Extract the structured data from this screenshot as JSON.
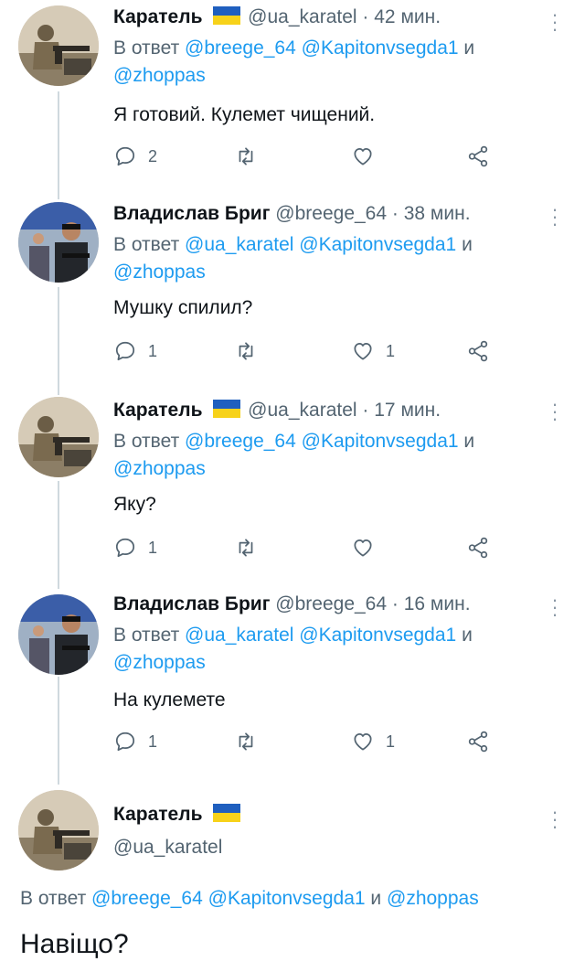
{
  "tweets": [
    {
      "name": "Каратель",
      "handle": "@ua_karatel",
      "sep": "·",
      "time": "42 мин.",
      "reply_prefix": "В ответ",
      "reply_to_1": "@breege_64",
      "reply_to_2": "@Kapitonvsegda1",
      "reply_and": "и",
      "reply_to_3": "@zhoppas",
      "text": "Я готовий. Кулемет чищений.",
      "replies": "2",
      "likes": ""
    },
    {
      "name": "Владислав Бриг",
      "handle": "@breege_64",
      "sep": "·",
      "time": "38 мин.",
      "reply_prefix": "В ответ",
      "reply_to_1": "@ua_karatel",
      "reply_to_2": "@Kapitonvsegda1",
      "reply_and": "и",
      "reply_to_3": "@zhoppas",
      "text": "Мушку спилил?",
      "replies": "1",
      "likes": "1"
    },
    {
      "name": "Каратель",
      "handle": "@ua_karatel",
      "sep": "·",
      "time": "17 мин.",
      "reply_prefix": "В ответ",
      "reply_to_1": "@breege_64",
      "reply_to_2": "@Kapitonvsegda1",
      "reply_and": "и",
      "reply_to_3": "@zhoppas",
      "text": "Яку?",
      "replies": "1",
      "likes": ""
    },
    {
      "name": "Владислав Бриг",
      "handle": "@breege_64",
      "sep": "·",
      "time": "16 мин.",
      "reply_prefix": "В ответ",
      "reply_to_1": "@ua_karatel",
      "reply_to_2": "@Kapitonvsegda1",
      "reply_and": "и",
      "reply_to_3": "@zhoppas",
      "text": "На кулемете",
      "replies": "1",
      "likes": "1"
    }
  ],
  "main_tweet": {
    "name": "Каратель",
    "handle": "@ua_karatel",
    "reply_prefix": "В ответ",
    "reply_to_1": "@breege_64",
    "reply_to_2": "@Kapitonvsegda1",
    "reply_and": "и",
    "reply_to_3": "@zhoppas",
    "text": "Навіщо?"
  },
  "icons": {
    "reply": "reply-icon",
    "retweet": "retweet-icon",
    "like": "heart-icon",
    "share": "share-icon",
    "more": "more-icon",
    "flag": "ukraine-flag-icon"
  },
  "colors": {
    "link": "#1d9bf0",
    "secondary": "#536471",
    "text": "#0f1419",
    "thread_line": "#cfd9de"
  }
}
